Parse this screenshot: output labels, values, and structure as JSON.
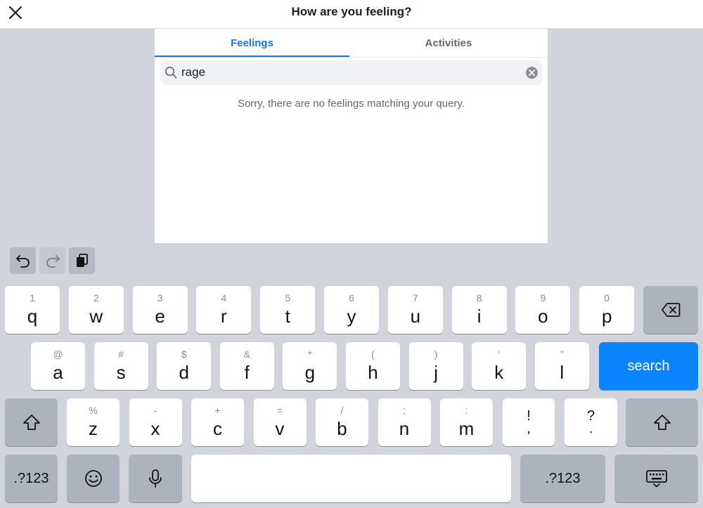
{
  "header": {
    "title": "How are you feeling?"
  },
  "tabs": [
    {
      "label": "Feelings"
    },
    {
      "label": "Activities"
    }
  ],
  "search": {
    "value": "rage"
  },
  "empty_message": "Sorry, there are no feelings matching your query.",
  "keyboard": {
    "row1": [
      {
        "hint": "1",
        "key": "q"
      },
      {
        "hint": "2",
        "key": "w"
      },
      {
        "hint": "3",
        "key": "e"
      },
      {
        "hint": "4",
        "key": "r"
      },
      {
        "hint": "5",
        "key": "t"
      },
      {
        "hint": "6",
        "key": "y"
      },
      {
        "hint": "7",
        "key": "u"
      },
      {
        "hint": "8",
        "key": "i"
      },
      {
        "hint": "9",
        "key": "o"
      },
      {
        "hint": "0",
        "key": "p"
      }
    ],
    "row2": [
      {
        "hint": "@",
        "key": "a"
      },
      {
        "hint": "#",
        "key": "s"
      },
      {
        "hint": "$",
        "key": "d"
      },
      {
        "hint": "&",
        "key": "f"
      },
      {
        "hint": "*",
        "key": "g"
      },
      {
        "hint": "(",
        "key": "h"
      },
      {
        "hint": ")",
        "key": "j"
      },
      {
        "hint": "’",
        "key": "k"
      },
      {
        "hint": "”",
        "key": "l"
      }
    ],
    "row3": [
      {
        "hint": "%",
        "key": "z"
      },
      {
        "hint": "-",
        "key": "x"
      },
      {
        "hint": "+",
        "key": "c"
      },
      {
        "hint": "=",
        "key": "v"
      },
      {
        "hint": "/",
        "key": "b"
      },
      {
        "hint": ";",
        "key": "n"
      },
      {
        "hint": ":",
        "key": "m"
      }
    ],
    "punct1": {
      "top": "!",
      "bottom": ","
    },
    "punct2": {
      "top": "?",
      "bottom": "."
    },
    "search_label": "search",
    "numbers_label": ".?123"
  },
  "colors": {
    "accent": "#1b74e4",
    "search_key": "#0a84ff"
  }
}
